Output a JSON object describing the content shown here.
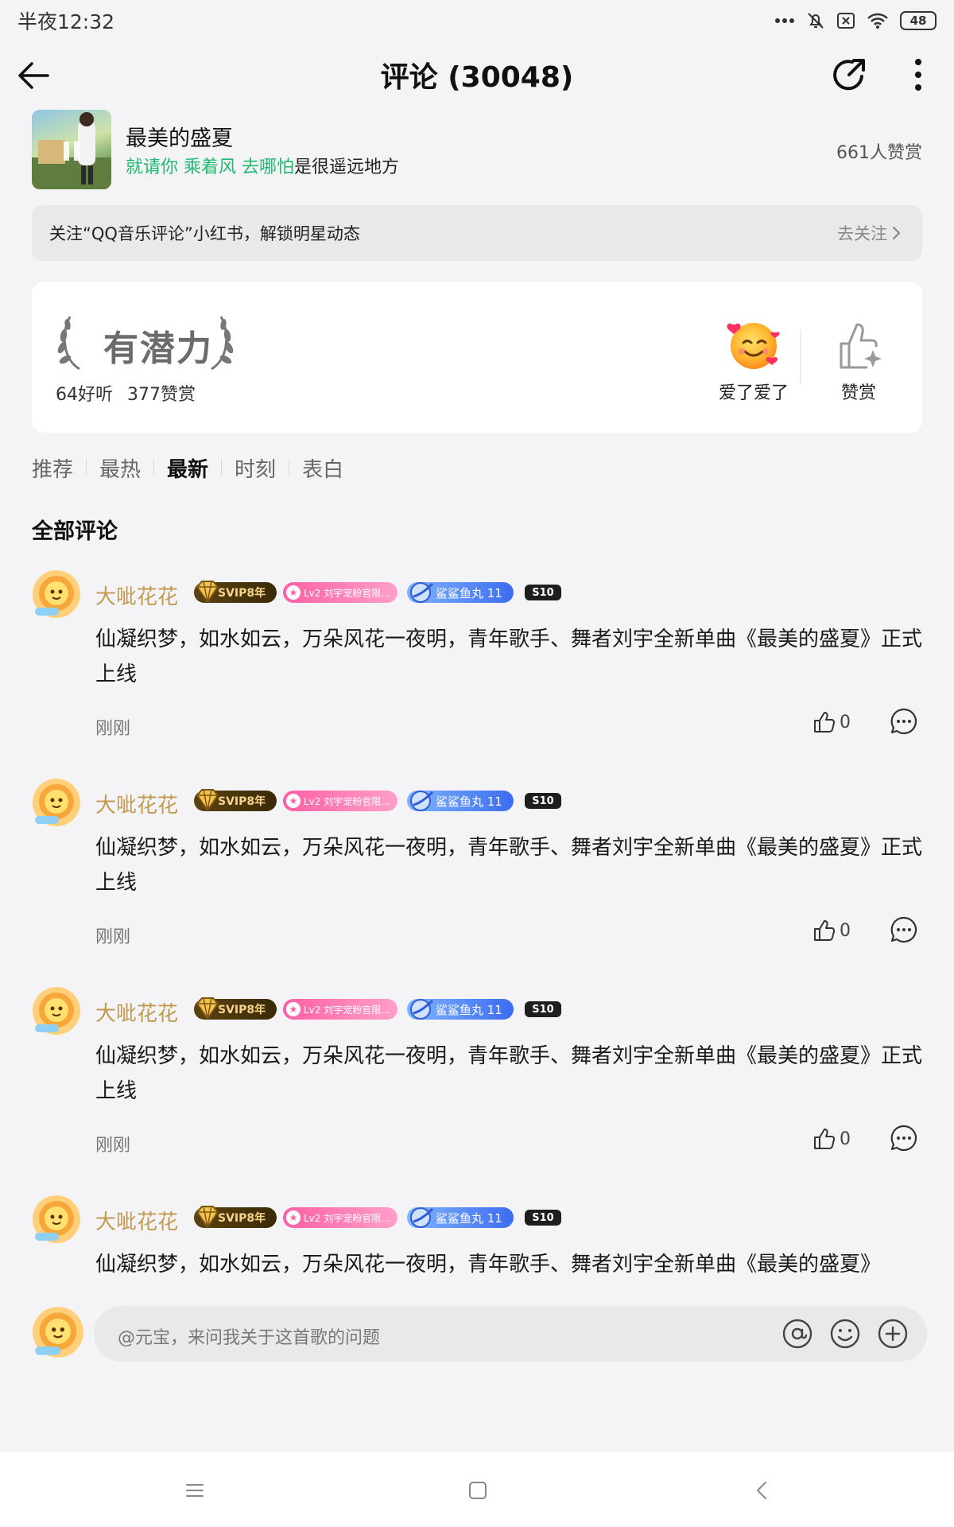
{
  "status_bar": {
    "time": "半夜12:32",
    "icons": [
      "more-dots-icon",
      "bell-muted-icon",
      "sim-off-icon",
      "wifi-icon"
    ],
    "battery": "48"
  },
  "header": {
    "title": "评论 (30048)",
    "icons": [
      "back-arrow-icon",
      "share-icon",
      "more-vertical-icon"
    ]
  },
  "song": {
    "title": "最美的盛夏",
    "lyric_highlight": "就请你 乘着风 去哪怕",
    "lyric_rest": "是很遥远地方",
    "reward_count": "661人赞赏"
  },
  "follow_banner": {
    "text": "关注“QQ音乐评论”小红书，解锁明星动态",
    "action": "去关注"
  },
  "potential": {
    "badge": "有潜力",
    "listens": "64好听",
    "rewards": "377赞赏",
    "love_label": "爱了爱了",
    "reward_label": "赞赏"
  },
  "tabs": [
    {
      "label": "推荐",
      "active": false
    },
    {
      "label": "最热",
      "active": false
    },
    {
      "label": "最新",
      "active": true
    },
    {
      "label": "时刻",
      "active": false
    },
    {
      "label": "表白",
      "active": false
    }
  ],
  "section_title": "全部评论",
  "badges": {
    "svip": "SVIP8年",
    "level": "Lv2 刘宇宠粉官限...",
    "fan": "鲨鲨鱼丸 11",
    "s10": "S10"
  },
  "comments": [
    {
      "user": "大呲花花",
      "text": "仙凝织梦，如水如云，万朵风花一夜明，青年歌手、舞者刘宇全新单曲《最美的盛夏》正式上线",
      "time": "刚刚",
      "likes": "0"
    },
    {
      "user": "大呲花花",
      "text": "仙凝织梦，如水如云，万朵风花一夜明，青年歌手、舞者刘宇全新单曲《最美的盛夏》正式上线",
      "time": "刚刚",
      "likes": "0"
    },
    {
      "user": "大呲花花",
      "text": "仙凝织梦，如水如云，万朵风花一夜明，青年歌手、舞者刘宇全新单曲《最美的盛夏》正式上线",
      "time": "刚刚",
      "likes": "0"
    },
    {
      "user": "大呲花花",
      "text": "仙凝织梦，如水如云，万朵风花一夜明，青年歌手、舞者刘宇全新单曲《最美的盛夏》",
      "time": "",
      "likes": ""
    }
  ],
  "input_bar": {
    "placeholder": "@元宝，来问我关于这首歌的问题",
    "icons": [
      "at-icon",
      "emoji-icon",
      "plus-icon"
    ]
  },
  "nav_bar": {
    "icons": [
      "menu-icon",
      "home-square-icon",
      "back-chevron-icon"
    ]
  },
  "colors": {
    "accent_green": "#1fb96f",
    "username_gold": "#c29a50",
    "background": "#f4f4f6"
  }
}
